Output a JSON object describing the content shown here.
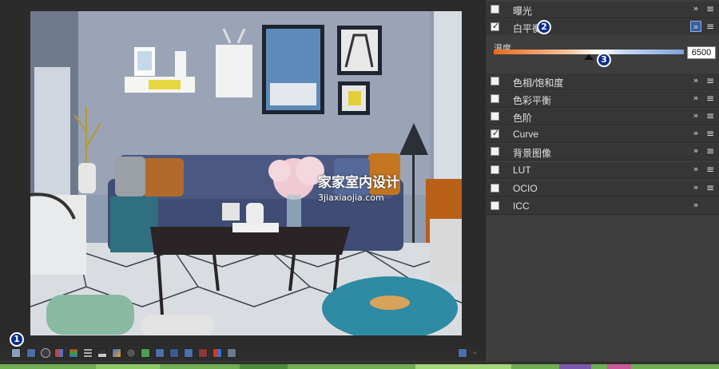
{
  "render_alt": "3D living room render",
  "watermark": {
    "line1": "家家室内设计",
    "line2": "3jiaxiaojia.com"
  },
  "panel": {
    "items": [
      {
        "label": "曝光",
        "checked": false
      },
      {
        "label": "白平衡",
        "checked": true
      },
      {
        "label": "色相/饱和度",
        "checked": false
      },
      {
        "label": "色彩平衡",
        "checked": false
      },
      {
        "label": "色阶",
        "checked": false
      },
      {
        "label": "Curve",
        "checked": true
      },
      {
        "label": "背景图像",
        "checked": false
      },
      {
        "label": "LUT",
        "checked": false
      },
      {
        "label": "OCIO",
        "checked": false
      },
      {
        "label": "ICC",
        "checked": false
      }
    ],
    "white_balance": {
      "temperature_label": "温度",
      "temperature_value": "6500",
      "temperature_position": 0.5
    }
  },
  "badges": {
    "b1": "1",
    "b2": "2",
    "b3": "3"
  },
  "icons": {
    "expand": "double-chevron-icon",
    "menu": "hamburger-icon",
    "check": "✓"
  },
  "colors": {
    "accent": "#0b2d8c",
    "panel_bg": "#3e3e3e",
    "row_bg": "#363636"
  }
}
